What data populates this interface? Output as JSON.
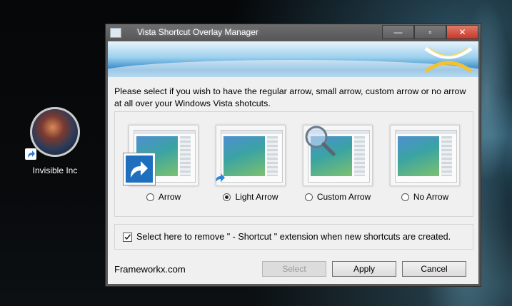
{
  "desktop": {
    "icon_label": "Invisible Inc"
  },
  "window": {
    "title": "Vista Shortcut Overlay Manager",
    "minimize_glyph": "—",
    "maximize_glyph": "▫",
    "close_glyph": "✕"
  },
  "instructions": "Please select if you wish to have the regular arrow, small arrow, custom arrow or no arrow at all over your Windows Vista shotcuts.",
  "options": [
    {
      "label": "Arrow",
      "selected": false
    },
    {
      "label": "Light Arrow",
      "selected": true
    },
    {
      "label": "Custom Arrow",
      "selected": false
    },
    {
      "label": "No Arrow",
      "selected": false
    }
  ],
  "remove_shortcut": {
    "checked": true,
    "label": "Select here to remove \" - Shortcut \" extension when new shortcuts are created."
  },
  "footer": {
    "link": "Frameworkx.com",
    "select_label": "Select",
    "apply_label": "Apply",
    "cancel_label": "Cancel"
  },
  "colors": {
    "banner_blue": "#2d86c6",
    "close_red": "#c7392a"
  }
}
